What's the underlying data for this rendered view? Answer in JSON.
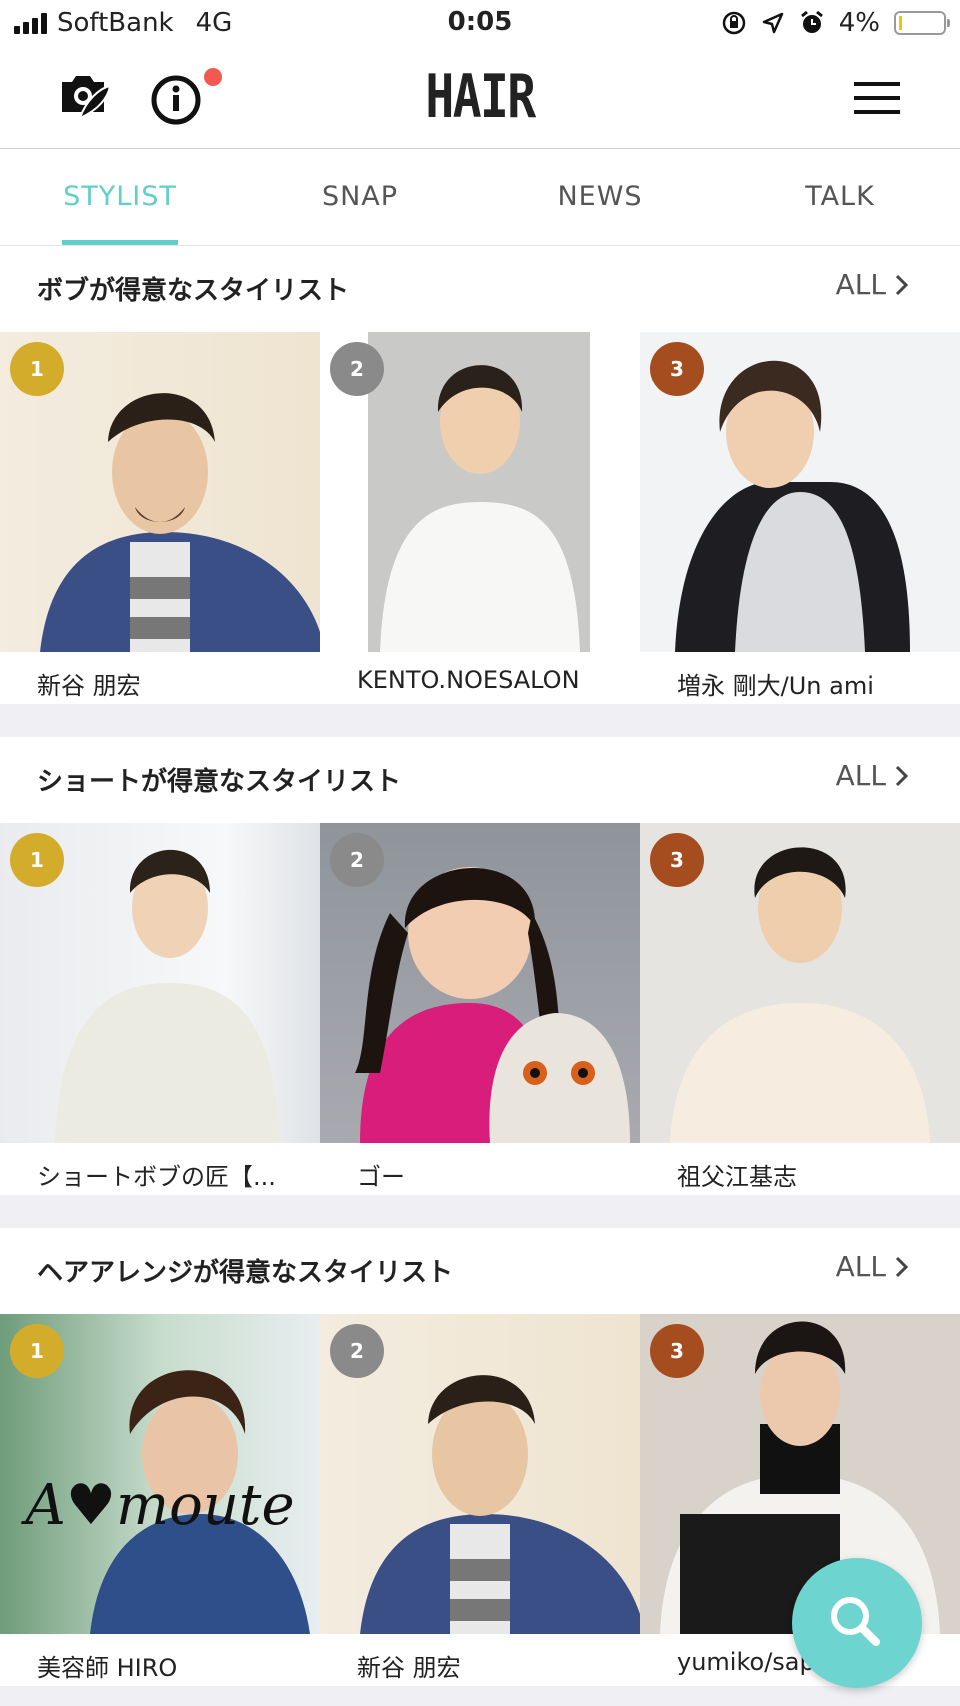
{
  "status_bar": {
    "carrier": "SoftBank",
    "network": "4G",
    "time": "0:05",
    "battery": "4%",
    "battery_level": 0.04
  },
  "navbar": {
    "logo": "HAIR",
    "left_icons": [
      "camera-feather-icon",
      "info-icon"
    ],
    "right_icon": "hamburger-menu-icon",
    "notification_dot_color": "#f35a4f"
  },
  "tabs": [
    {
      "label": "STYLIST",
      "active": true
    },
    {
      "label": "SNAP",
      "active": false
    },
    {
      "label": "NEWS",
      "active": false
    },
    {
      "label": "TALK",
      "active": false
    }
  ],
  "colors": {
    "accent": "#5fcfcb",
    "rank_1": "#d4ac2b",
    "rank_2": "#8a8a8a",
    "rank_3": "#a54d1f",
    "fab": "#6dd4d0"
  },
  "sections": [
    {
      "title": "ボブが得意なスタイリスト",
      "all_label": "ALL",
      "stylists": [
        {
          "rank": "1",
          "name": "新谷 朋宏"
        },
        {
          "rank": "2",
          "name": "KENTO.NOESALON"
        },
        {
          "rank": "3",
          "name": "増永 剛大/Un ami"
        }
      ]
    },
    {
      "title": "ショートが得意なスタイリスト",
      "all_label": "ALL",
      "stylists": [
        {
          "rank": "1",
          "name": "ショートボブの匠【..."
        },
        {
          "rank": "2",
          "name": "ゴー"
        },
        {
          "rank": "3",
          "name": "祖父江基志"
        }
      ]
    },
    {
      "title": "ヘアアレンジが得意なスタイリスト",
      "all_label": "ALL",
      "stylists": [
        {
          "rank": "1",
          "name": "美容師 HIRO",
          "photo_text": "A♥moute"
        },
        {
          "rank": "2",
          "name": "新谷 朋宏"
        },
        {
          "rank": "3",
          "name": "yumiko/sap..."
        }
      ]
    }
  ],
  "fab": {
    "icon": "search-icon"
  }
}
